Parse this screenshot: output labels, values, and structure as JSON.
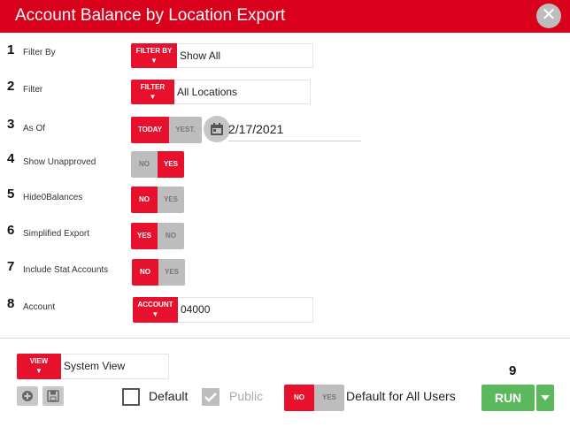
{
  "window": {
    "title": "Account Balance by Location Export",
    "close_icon": "✕"
  },
  "rows": [
    {
      "num": "1",
      "label": "Filter By",
      "button_label": "FILTER BY",
      "value": "Show All"
    },
    {
      "num": "2",
      "label": "Filter",
      "button_label": "FILTER",
      "value": "All Locations"
    },
    {
      "num": "3",
      "label": "As Of",
      "options": [
        "TODAY",
        "YEST."
      ],
      "selected": "TODAY",
      "date": "2/17/2021"
    },
    {
      "num": "4",
      "label": "Show Unapproved",
      "options": [
        "NO",
        "YES"
      ],
      "selected": "YES"
    },
    {
      "num": "5",
      "label": "Hide0Balances",
      "options": [
        "NO",
        "YES"
      ],
      "selected": "NO"
    },
    {
      "num": "6",
      "label": "Simplified Export",
      "options": [
        "YES",
        "NO"
      ],
      "selected": "YES"
    },
    {
      "num": "7",
      "label": "Include Stat Accounts",
      "options": [
        "NO",
        "YES"
      ],
      "selected": "NO"
    },
    {
      "num": "8",
      "label": "Account",
      "button_label": "ACCOUNT",
      "value": "04000"
    }
  ],
  "caret": "▼",
  "footer": {
    "view_button_label": "VIEW",
    "view_value": "System View",
    "default_label": "Default",
    "default_checked": false,
    "public_label": "Public",
    "public_checked": true,
    "all_users_options": [
      "NO",
      "YES"
    ],
    "all_users_selected": "NO",
    "all_users_label": "Default for All Users",
    "step_number": "9",
    "run_label": "RUN"
  },
  "colors": {
    "accent": "#e8112d",
    "titlebar": "#d9001b",
    "run": "#5cb85c",
    "inactive": "#bdbdbd"
  },
  "icons": [
    "close-icon",
    "calendar-icon",
    "add-circle-icon",
    "save-icon",
    "caret-down-icon",
    "check-icon"
  ]
}
